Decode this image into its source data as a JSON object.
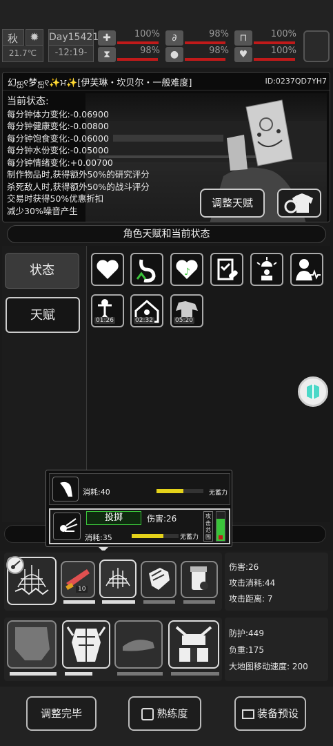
{
  "topbar": {
    "season": "秋",
    "temperature": "21.7℃",
    "day": "Day15421",
    "time": "12:19",
    "stats": [
      {
        "icon": "medkit-icon",
        "percent": "100%",
        "level": 1.0
      },
      {
        "icon": "stomach-icon",
        "percent": "98%",
        "level": 0.98
      },
      {
        "icon": "bladder-icon",
        "percent": "100%",
        "level": 1.0
      },
      {
        "icon": "hourglass-icon",
        "percent": "98%",
        "level": 0.98
      },
      {
        "icon": "water-drop-icon",
        "percent": "98%",
        "level": 0.98
      },
      {
        "icon": "heart-icon",
        "percent": "100%",
        "level": 1.0
      }
    ]
  },
  "character": {
    "name_line": "幻ஐ୧梦ஐ୧✨ਮ✨[伊芙琳・坎贝尔・一般难度]",
    "id": "ID:0237QD7YH7",
    "status_title": "当前状态:",
    "status_lines": [
      "每分钟体力变化:-0.06900",
      "每分钟健康变化:-0.00800",
      "每分钟饱食变化:-0.06000",
      "每分钟水份变化:-0.05000",
      "每分钟情绪变化:+0.00700",
      "制作物品时,获得额外50%的研究评分",
      "杀死敌人时,获得额外50%的战斗评分",
      "交易时获得50%优惠折扣",
      "减少30%噪音产生"
    ],
    "adjust_talent_label": "调整天赋"
  },
  "section_title": "角色天赋和当前状态",
  "tabs": {
    "status": "状态",
    "talent": "天赋"
  },
  "status_tiles": [
    {
      "icon": "heart-icon"
    },
    {
      "icon": "stomach-up-icon"
    },
    {
      "icon": "heart-music-icon"
    },
    {
      "icon": "clipboard-pill-icon"
    },
    {
      "icon": "alarm-person-icon"
    },
    {
      "icon": "person-heartbeat-icon"
    },
    {
      "icon": "exercise-icon",
      "timer": "01:26"
    },
    {
      "icon": "house-sick-icon",
      "timer": "02:32"
    },
    {
      "icon": "clothes-icon",
      "timer": "05:20"
    }
  ],
  "popup": {
    "row1": {
      "cost": "消耗:40",
      "no_power": "无蓄力",
      "fill": 0.58
    },
    "row2": {
      "action": "投掷",
      "damage": "伤害:26",
      "cost": "消耗:35",
      "no_power": "无蓄力",
      "range_label": "攻击范围",
      "fill": 0.68
    }
  },
  "weapon": {
    "count": "10",
    "stats": [
      "伤害:26",
      "攻击消耗:44",
      "攻击距离: 7"
    ]
  },
  "armor": {
    "stats": [
      "防护:449",
      "负重:175",
      "大地图移动速度: 200"
    ]
  },
  "bottom": {
    "done_label": "调整完毕",
    "proficiency_label": "熟练度",
    "preset_label": "装备预设"
  },
  "colors": {
    "health_bar": "#c01a1a",
    "stamina_bar": "#e4d21a",
    "accent_green": "#3ac43a",
    "float_button": "#4ad8c8"
  }
}
